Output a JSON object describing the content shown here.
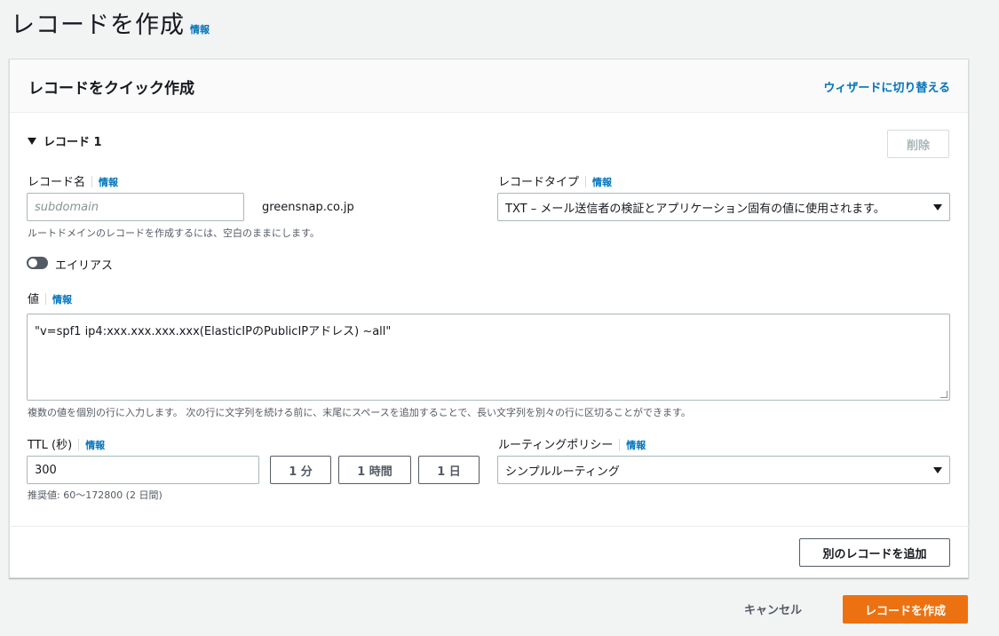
{
  "page": {
    "title": "レコードを作成",
    "info": "情報"
  },
  "panel": {
    "title": "レコードをクイック作成",
    "wizard_link": "ウィザードに切り替える"
  },
  "record": {
    "section_label": "レコード 1",
    "delete_button": "削除",
    "name": {
      "label": "レコード名",
      "info": "情報",
      "placeholder": "subdomain",
      "domain_suffix": "greensnap.co.jp",
      "hint": "ルートドメインのレコードを作成するには、空白のままにします。"
    },
    "type": {
      "label": "レコードタイプ",
      "info": "情報",
      "selected": "TXT – メール送信者の検証とアプリケーション固有の値に使用されます。"
    },
    "alias": {
      "label": "エイリアス",
      "enabled": false
    },
    "value": {
      "label": "値",
      "info": "情報",
      "text": "\"v=spf1 ip4:xxx.xxx.xxx.xxx(ElasticIPのPublicIPアドレス) ~all\"",
      "hint": "複数の値を個別の行に入力します。 次の行に文字列を続ける前に、末尾にスペースを追加することで、長い文字列を別々の行に区切ることができます。"
    },
    "ttl": {
      "label": "TTL (秒)",
      "info": "情報",
      "value": "300",
      "preset_1m": "1 分",
      "preset_1h": "1 時間",
      "preset_1d": "1 日",
      "hint": "推奨値: 60〜172800 (2 日間)"
    },
    "routing": {
      "label": "ルーティングポリシー",
      "info": "情報",
      "selected": "シンプルルーティング"
    }
  },
  "add_record_button": "別のレコードを追加",
  "footer": {
    "cancel": "キャンセル",
    "create": "レコードを作成"
  },
  "icons": {
    "expand": "caret-down-icon",
    "select": "dropdown-caret-icon"
  },
  "colors": {
    "accent": "#ec7211",
    "link": "#0073bb",
    "background": "#f2f3f3"
  }
}
